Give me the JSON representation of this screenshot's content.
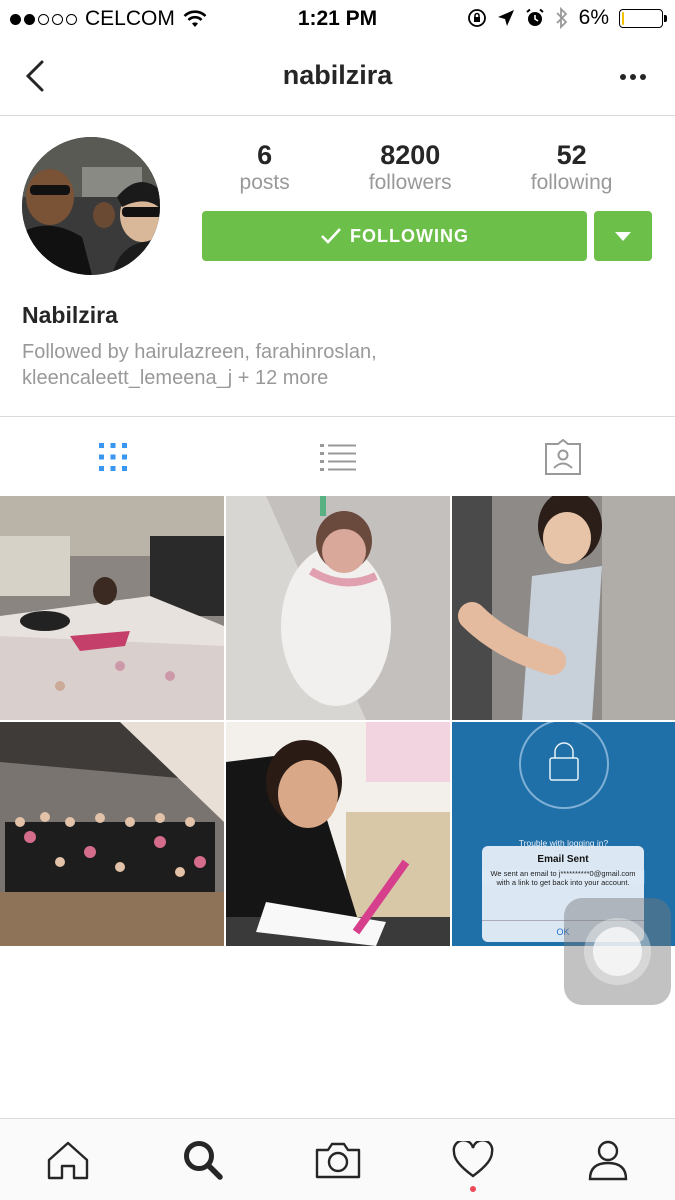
{
  "status_bar": {
    "carrier": "CELCOM",
    "time": "1:21 PM",
    "battery_percent": "6%",
    "battery_level": 0.06,
    "signal_bars_filled": 2,
    "signal_bars_total": 5
  },
  "nav": {
    "username": "nabilzira"
  },
  "profile": {
    "posts_count": "6",
    "posts_label": "posts",
    "followers_count": "8200",
    "followers_label": "followers",
    "following_count": "52",
    "following_label": "following",
    "following_button": "FOLLOWING",
    "full_name": "Nabilzira",
    "followed_by_line1": "Followed by hairulazreen, farahinroslan,",
    "followed_by_line2": "kleencaleett_lemeena_j + 12 more"
  },
  "view_tabs": [
    {
      "icon": "grid-icon",
      "active": true
    },
    {
      "icon": "list-icon",
      "active": false
    },
    {
      "icon": "tagged-icon",
      "active": false
    }
  ],
  "grid_post_6": {
    "trouble_text": "Trouble with logging in?",
    "alert_title": "Email Sent",
    "alert_body": "We sent an email to j**********0@gmail.com with a link to get back into your account.",
    "alert_button": "OK"
  },
  "bottom_bar": [
    {
      "icon": "home-icon"
    },
    {
      "icon": "search-icon",
      "active": true
    },
    {
      "icon": "camera-icon"
    },
    {
      "icon": "heart-icon",
      "has_notification": true
    },
    {
      "icon": "profile-icon"
    }
  ],
  "colors": {
    "accent_green": "#6cc04a",
    "active_blue": "#3897f0",
    "notification_red": "#ed4956"
  }
}
